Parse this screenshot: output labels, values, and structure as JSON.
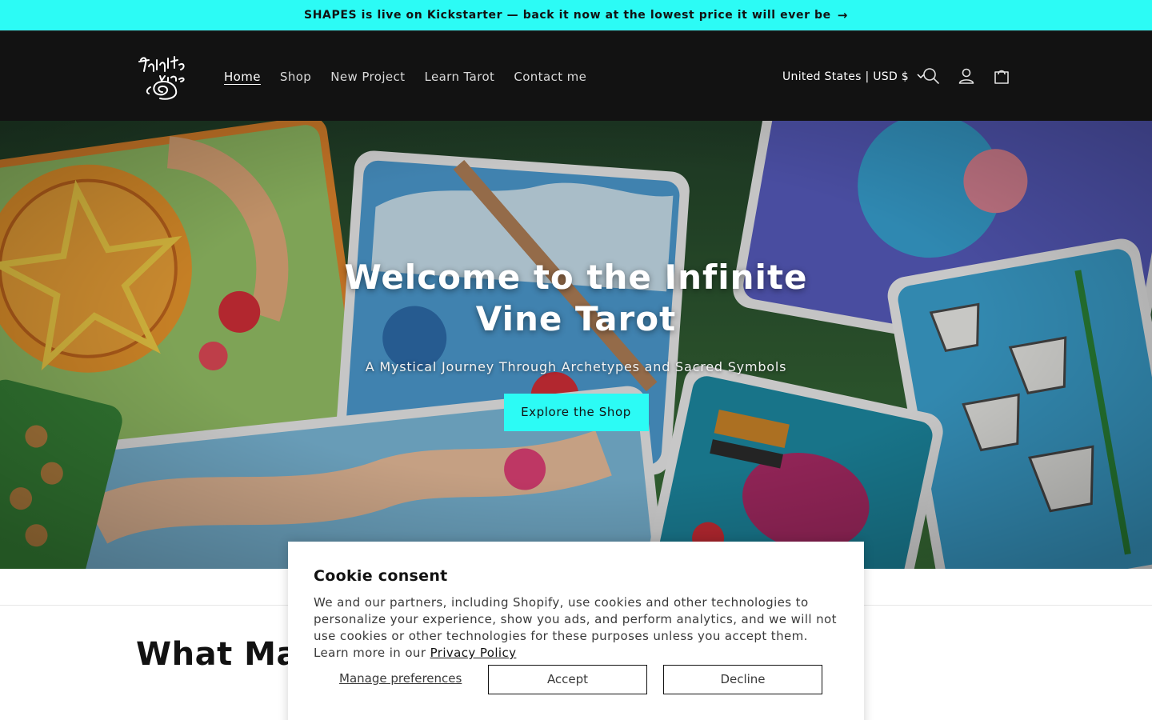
{
  "announcement": {
    "text": "SHAPES is live on Kickstarter — back it now at the lowest price it will ever be",
    "arrow": "→"
  },
  "header": {
    "logo_alt": "Infinite Vine",
    "nav": [
      {
        "label": "Home",
        "active": true
      },
      {
        "label": "Shop",
        "active": false
      },
      {
        "label": "New Project",
        "active": false
      },
      {
        "label": "Learn Tarot",
        "active": false
      },
      {
        "label": "Contact me",
        "active": false
      }
    ],
    "locale": "United States | USD $",
    "icons": [
      "search-icon",
      "account-icon",
      "cart-icon"
    ]
  },
  "hero": {
    "title": "Welcome to the Infinite Vine Tarot",
    "subtitle": "A Mystical Journey Through Archetypes and Sacred Symbols",
    "button_label": "Explore the Shop"
  },
  "section": {
    "title_visible": "What Ma"
  },
  "cookie": {
    "title": "Cookie consent",
    "text": "We and our partners, including Shopify, use cookies and other technologies to personalize your experience, show you ads, and perform analytics, and we will not use cookies or other technologies for these purposes unless you accept them. Learn more in our ",
    "link_label": "Privacy Policy",
    "manage_label": "Manage preferences",
    "accept_label": "Accept",
    "decline_label": "Decline"
  },
  "colors": {
    "accent": "#2cfbf5",
    "header_bg": "#121212"
  }
}
